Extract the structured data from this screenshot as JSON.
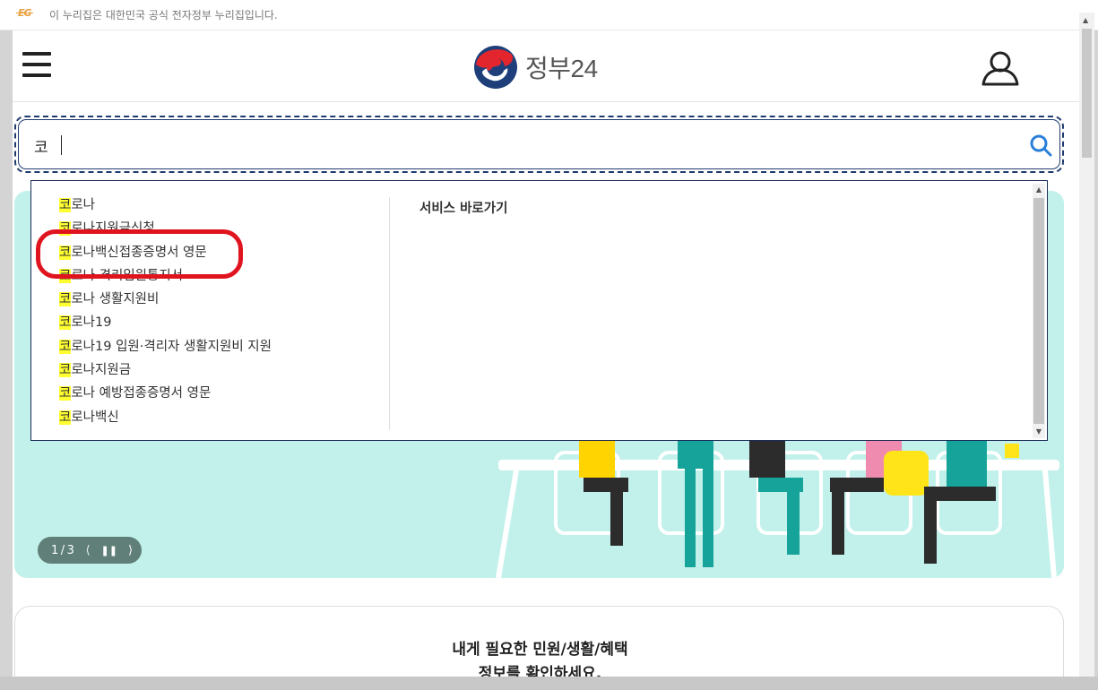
{
  "notice": {
    "badge": "EG",
    "text": "이 누리집은 대한민국 공식 전자정부 누리집입니다."
  },
  "header": {
    "logo_text": "정부24",
    "menu_icon": "hamburger-menu-icon",
    "user_icon": "user-icon"
  },
  "search": {
    "value": "코",
    "icon": "search-icon",
    "accent": "#1f3b6e",
    "icon_color": "#2b7fd9"
  },
  "dropdown": {
    "suggestions": [
      {
        "highlight": "코",
        "rest": "로나"
      },
      {
        "highlight": "코",
        "rest": "로나지원금신청"
      },
      {
        "highlight": "코",
        "rest": "로나백신접종증명서 영문"
      },
      {
        "highlight": "코",
        "rest": "로나 격리입원통지서"
      },
      {
        "highlight": "코",
        "rest": "로나 생활지원비"
      },
      {
        "highlight": "코",
        "rest": "로나19"
      },
      {
        "highlight": "코",
        "rest": "로나19 입원·격리자 생활지원비 지원"
      },
      {
        "highlight": "코",
        "rest": "로나지원금"
      },
      {
        "highlight": "코",
        "rest": "로나 예방접종증명서 영문"
      },
      {
        "highlight": "코",
        "rest": "로나백신"
      }
    ],
    "service_title": "서비스 바로가기",
    "highlight_color": "#ffff30"
  },
  "hero": {
    "pager": {
      "current": "1",
      "separator": "/",
      "total": "3"
    },
    "background": "#c1f1ea"
  },
  "card": {
    "line1": "내게 필요한 민원/생활/혜택",
    "line2": "정보를 확인하세요."
  },
  "annotation_color": "#e0141e"
}
